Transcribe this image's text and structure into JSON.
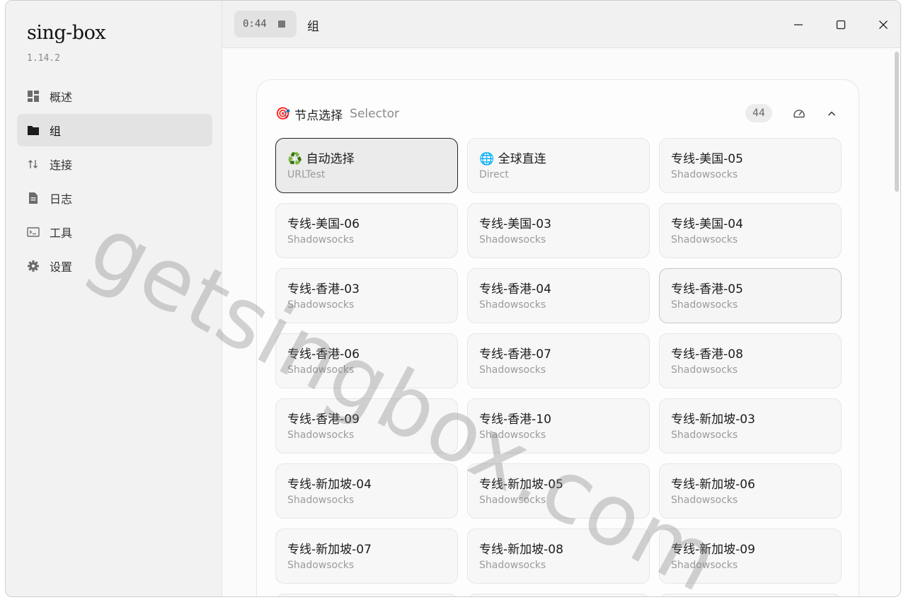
{
  "app": {
    "title": "sing-box",
    "version": "1.14.2"
  },
  "sidebar": {
    "items": [
      {
        "label": "概述",
        "icon": "dashboard-icon",
        "active": false
      },
      {
        "label": "组",
        "icon": "folder-icon",
        "active": true
      },
      {
        "label": "连接",
        "icon": "swap-vertical-icon",
        "active": false
      },
      {
        "label": "日志",
        "icon": "document-icon",
        "active": false
      },
      {
        "label": "工具",
        "icon": "terminal-icon",
        "active": false
      },
      {
        "label": "设置",
        "icon": "gear-icon",
        "active": false
      }
    ]
  },
  "titlebar": {
    "timer": "0:44",
    "page_title": "组"
  },
  "group": {
    "emoji": "🎯",
    "name": "节点选择",
    "type": "Selector",
    "count": "44",
    "nodes": [
      {
        "title": "♻️ 自动选择",
        "sub": "URLTest"
      },
      {
        "title": "🌐 全球直连",
        "sub": "Direct"
      },
      {
        "title": "专线-美国-05",
        "sub": "Shadowsocks"
      },
      {
        "title": "专线-美国-06",
        "sub": "Shadowsocks"
      },
      {
        "title": "专线-美国-03",
        "sub": "Shadowsocks"
      },
      {
        "title": "专线-美国-04",
        "sub": "Shadowsocks"
      },
      {
        "title": "专线-香港-03",
        "sub": "Shadowsocks"
      },
      {
        "title": "专线-香港-04",
        "sub": "Shadowsocks"
      },
      {
        "title": "专线-香港-05",
        "sub": "Shadowsocks"
      },
      {
        "title": "专线-香港-06",
        "sub": "Shadowsocks"
      },
      {
        "title": "专线-香港-07",
        "sub": "Shadowsocks"
      },
      {
        "title": "专线-香港-08",
        "sub": "Shadowsocks"
      },
      {
        "title": "专线-香港-09",
        "sub": "Shadowsocks"
      },
      {
        "title": "专线-香港-10",
        "sub": "Shadowsocks"
      },
      {
        "title": "专线-新加坡-03",
        "sub": "Shadowsocks"
      },
      {
        "title": "专线-新加坡-04",
        "sub": "Shadowsocks"
      },
      {
        "title": "专线-新加坡-05",
        "sub": "Shadowsocks"
      },
      {
        "title": "专线-新加坡-06",
        "sub": "Shadowsocks"
      },
      {
        "title": "专线-新加坡-07",
        "sub": "Shadowsocks"
      },
      {
        "title": "专线-新加坡-08",
        "sub": "Shadowsocks"
      },
      {
        "title": "专线-新加坡-09",
        "sub": "Shadowsocks"
      }
    ]
  },
  "watermark": "getsingbox.com"
}
